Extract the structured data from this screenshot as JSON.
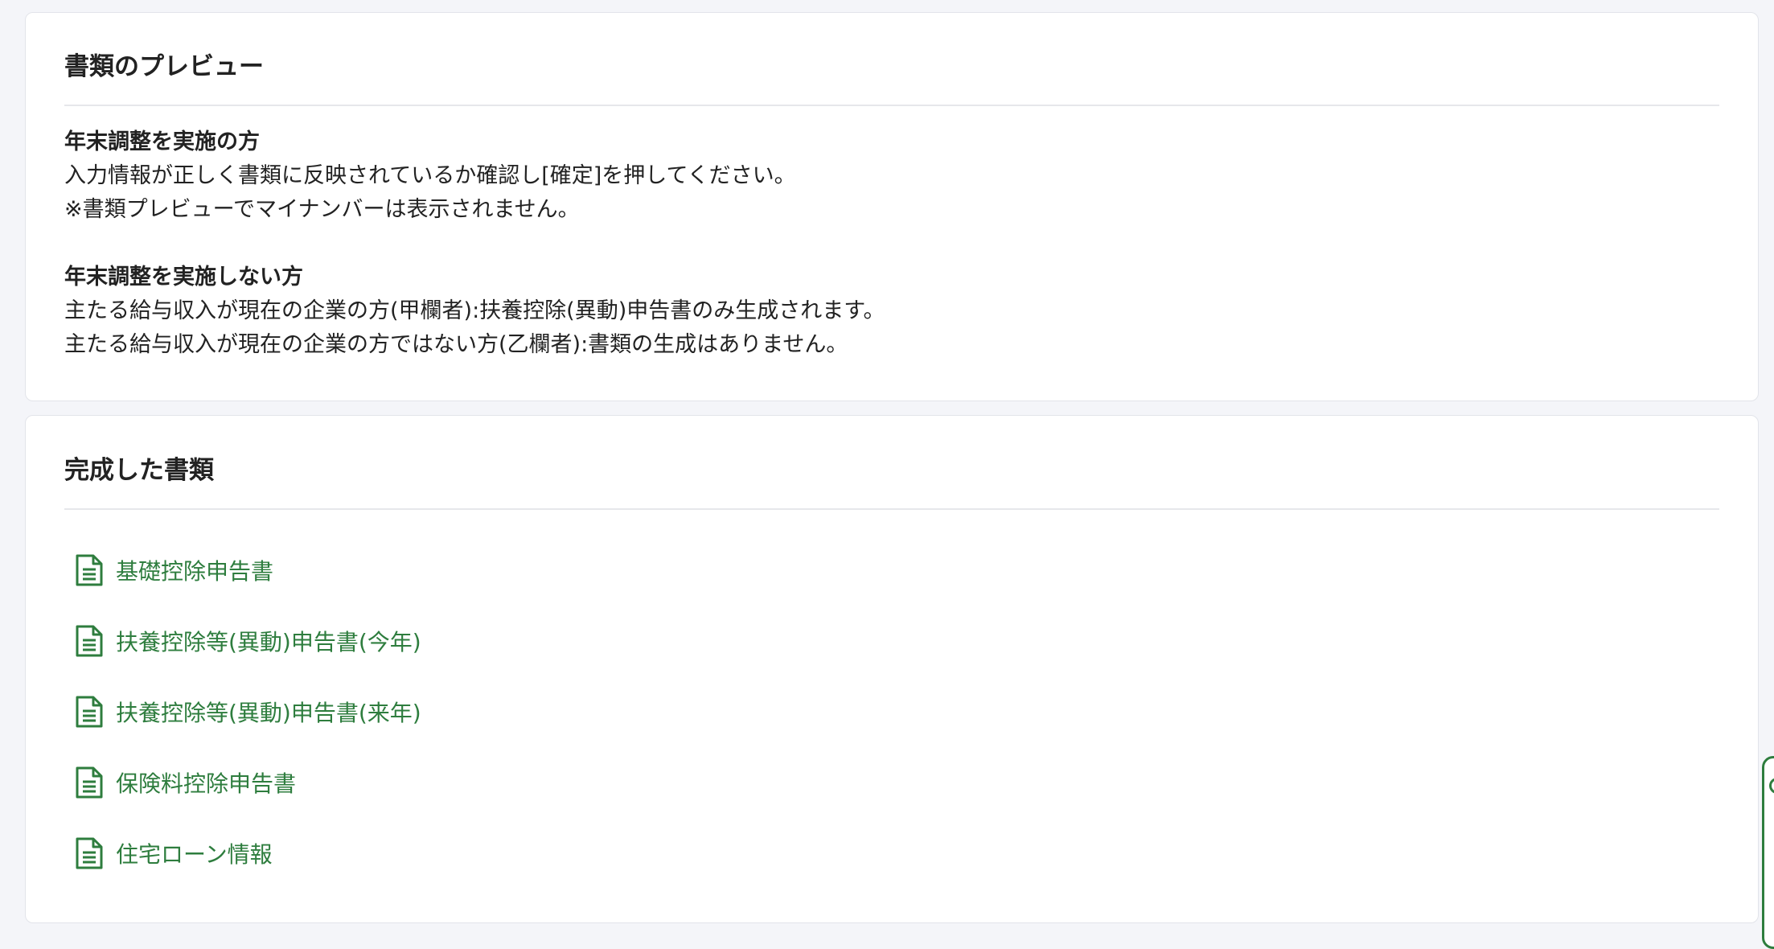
{
  "preview": {
    "title": "書類のプレビュー",
    "do_adjustment": {
      "heading": "年末調整を実施の方",
      "lines": [
        "入力情報が正しく書類に反映されているか確認し[確定]を押してください。",
        "※書類プレビューでマイナンバーは表示されません。"
      ]
    },
    "no_adjustment": {
      "heading": "年末調整を実施しない方",
      "lines": [
        "主たる給与収入が現在の企業の方(甲欄者):扶養控除(異動)申告書のみ生成されます。",
        "主たる給与収入が現在の企業の方ではない方(乙欄者):書類の生成はありません。"
      ]
    }
  },
  "documents": {
    "title": "完成した書類",
    "items": [
      {
        "label": "基礎控除申告書",
        "icon": "document-icon"
      },
      {
        "label": "扶養控除等(異動)申告書(今年)",
        "icon": "document-icon"
      },
      {
        "label": "扶養控除等(異動)申告書(来年)",
        "icon": "document-icon"
      },
      {
        "label": "保険料控除申告書",
        "icon": "document-icon"
      },
      {
        "label": "住宅ローン情報",
        "icon": "document-icon"
      }
    ]
  },
  "colors": {
    "link": "#2e7d3e",
    "background": "#f4f5f9",
    "card": "#ffffff",
    "divider": "#e6e7eb"
  }
}
